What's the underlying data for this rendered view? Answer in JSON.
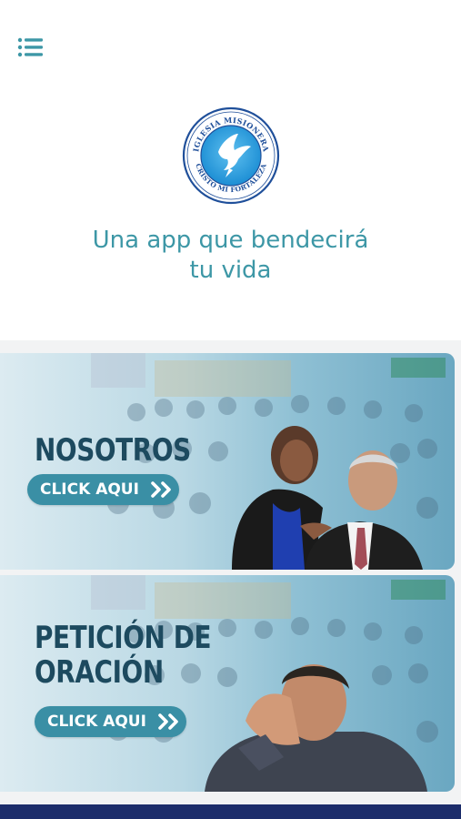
{
  "header": {
    "menu_icon": "menu-list-icon",
    "logo": {
      "top_text": "IGLESIA MISIONERA",
      "bottom_text": "CRISTO MI FORTALEZA",
      "emblem": "dove-icon"
    }
  },
  "hero": {
    "tagline_line1": "Una app que bendecirá",
    "tagline_line2": "tu vida"
  },
  "cards": [
    {
      "title_lines": [
        "NOSOTROS"
      ],
      "button_label": "CLICK AQUI",
      "button_icon": "double-chevron-right-icon"
    },
    {
      "title_lines": [
        "PETICIÓN DE",
        "ORACIÓN"
      ],
      "button_label": "CLICK AQUI",
      "button_icon": "double-chevron-right-icon"
    }
  ],
  "colors": {
    "accent": "#3d97a6",
    "card_title": "#1d4a5f",
    "button": "#3a8fa5",
    "footer": "#1c2d6b"
  }
}
